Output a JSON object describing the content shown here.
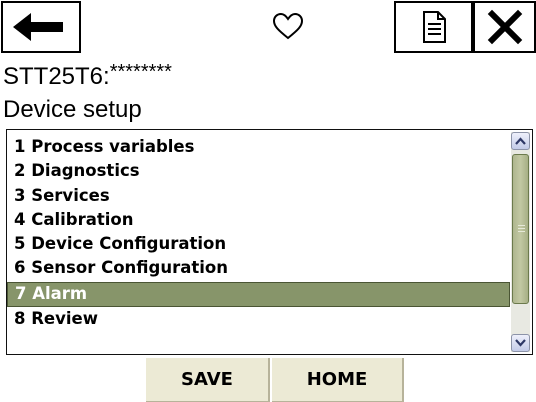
{
  "toolbar": {
    "back_icon": "arrow-left-icon",
    "favorite_icon": "heart-outline-icon",
    "document_icon": "document-icon",
    "close_icon": "close-x-icon"
  },
  "device": {
    "tag_label": "STT25T6:",
    "tag_masked": "********"
  },
  "menu": {
    "title": "Device setup",
    "items": [
      "1 Process variables",
      "2 Diagnostics",
      "3 Services",
      "4 Calibration",
      "5 Device Configuration",
      "6 Sensor Configuration",
      "7 Alarm",
      "8 Review"
    ],
    "selected_index": 6
  },
  "buttons": {
    "save_label": "SAVE",
    "home_label": "HOME"
  },
  "colors": {
    "selected_row": "#87956a",
    "button_bg": "#ecead5",
    "scroll_thumb": "#b5bd95"
  }
}
